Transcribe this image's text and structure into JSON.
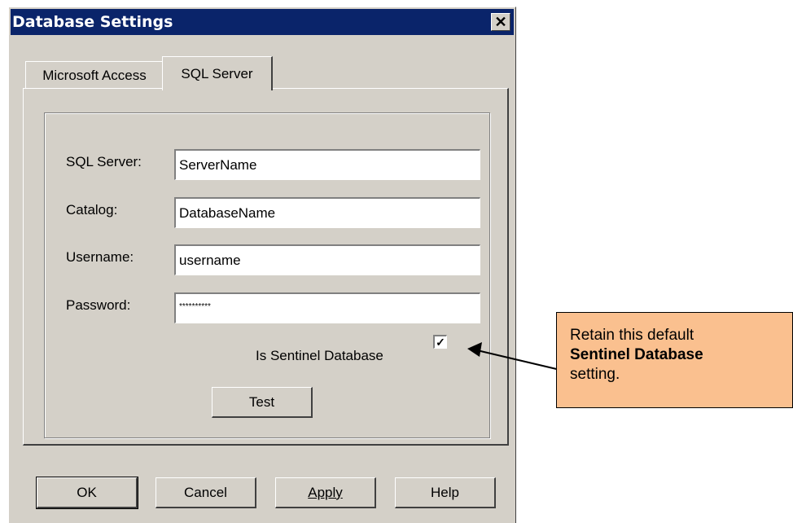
{
  "window": {
    "title": "Database Settings",
    "close_symbol": "✕"
  },
  "tabs": [
    {
      "label": "Microsoft Access",
      "active": false
    },
    {
      "label": "SQL Server",
      "active": true
    }
  ],
  "form": {
    "sql_server_label": "SQL Server:",
    "sql_server_value": "ServerName",
    "catalog_label": "Catalog:",
    "catalog_value": "DatabaseName",
    "username_label": "Username:",
    "username_value": "username",
    "password_label": "Password:",
    "password_value": "**********",
    "sentinel_label": "Is Sentinel Database",
    "sentinel_checked": true,
    "test_button": "Test"
  },
  "buttons": {
    "ok": "OK",
    "cancel": "Cancel",
    "apply": "Apply",
    "help": "Help"
  },
  "callout": {
    "text_before": "Retain this default",
    "text_bold": "Sentinel Database",
    "text_after": "setting."
  },
  "colors": {
    "titlebar": "#0a246a",
    "dialog_face": "#d4d0c8",
    "callout_fill": "#fac08f"
  }
}
